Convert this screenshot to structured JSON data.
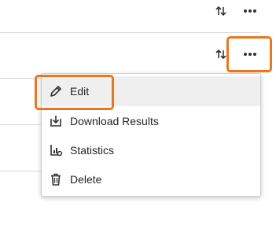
{
  "toolbar_rows": [
    {
      "sort_icon": "sort-arrows-icon",
      "more_icon": "more-horizontal-icon"
    },
    {
      "sort_icon": "sort-arrows-icon",
      "more_icon": "more-horizontal-icon"
    }
  ],
  "menu": {
    "items": [
      {
        "label": "Edit",
        "icon": "pencil-icon",
        "state": "hovered"
      },
      {
        "label": "Download Results",
        "icon": "download-icon"
      },
      {
        "label": "Statistics",
        "icon": "statistics-icon"
      },
      {
        "label": "Delete",
        "icon": "trash-icon"
      }
    ]
  },
  "colors": {
    "highlight": "#e87722",
    "icon": "#333333",
    "hover_bg": "#efefef",
    "divider": "#d6d6d6"
  }
}
